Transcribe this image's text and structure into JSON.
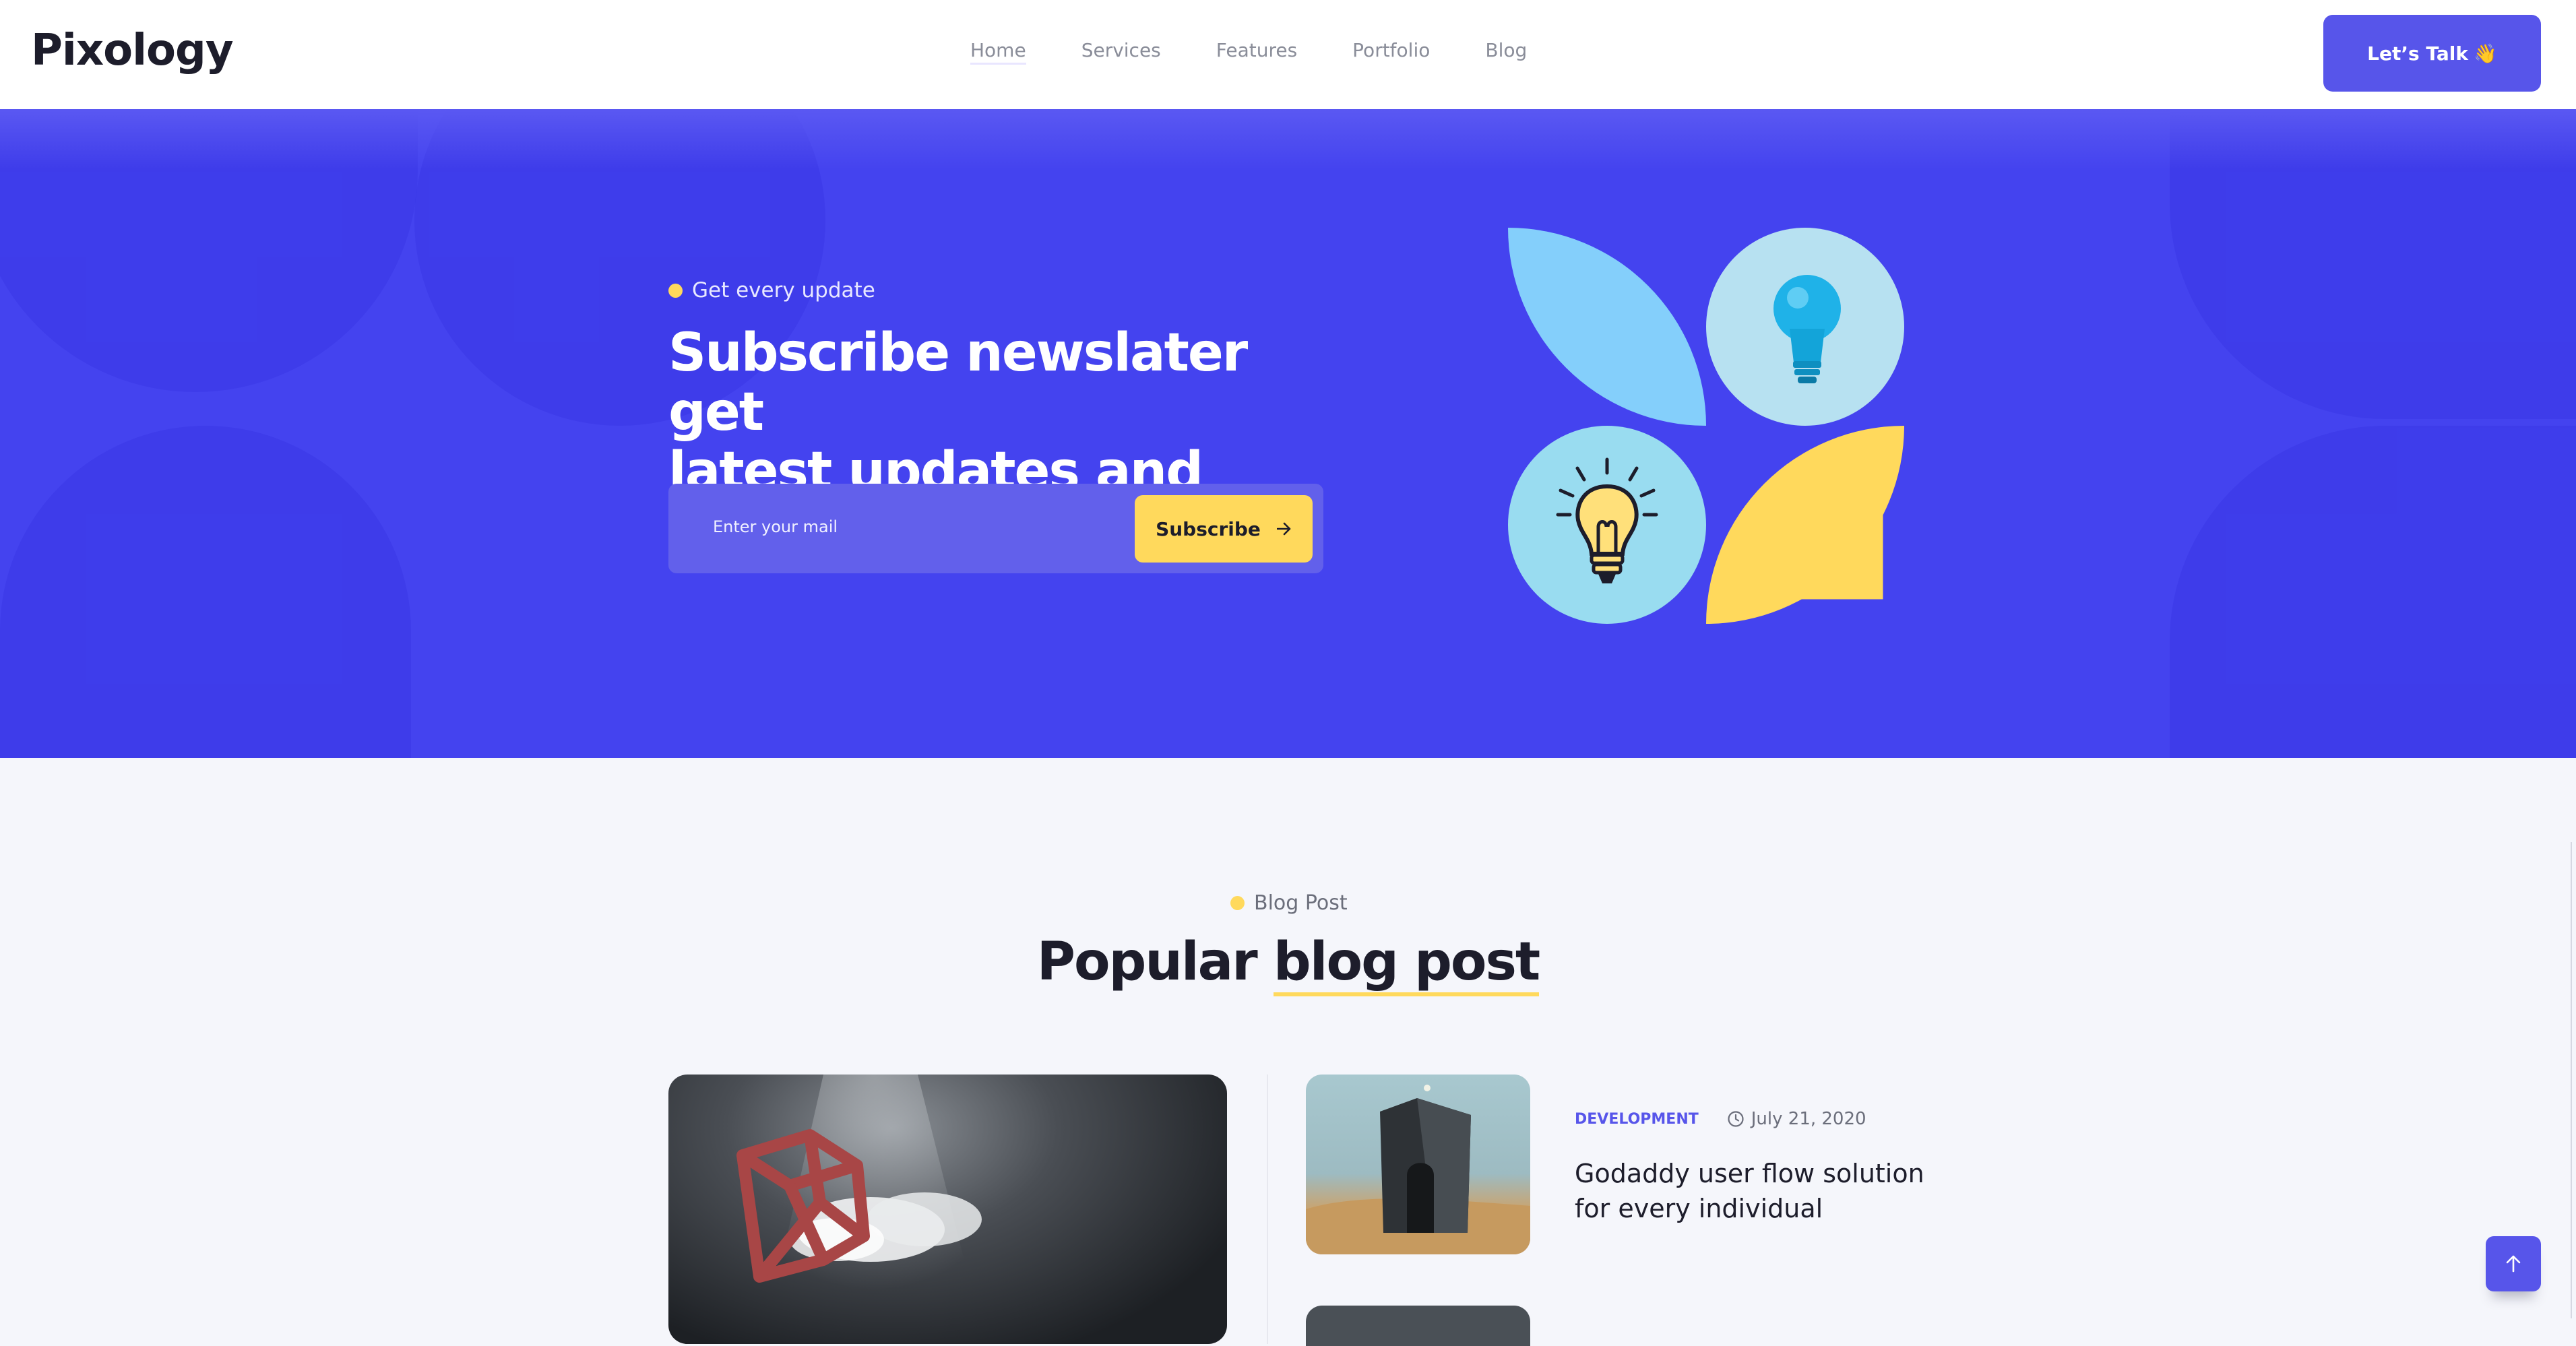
{
  "header": {
    "logo": "Pixology",
    "nav": [
      {
        "label": "Home"
      },
      {
        "label": "Services"
      },
      {
        "label": "Features"
      },
      {
        "label": "Portfolio"
      },
      {
        "label": "Blog"
      }
    ],
    "cta_label": "Let’s Talk",
    "cta_icon": "👋"
  },
  "hero": {
    "eyebrow": "Get every update",
    "title_line1": "Subscribe newslater get",
    "title_line2": "latest updates and deals",
    "email_placeholder": "Enter your mail",
    "subscribe_label": "Subscribe",
    "subscribe_icon": "arrow-right-icon"
  },
  "blog": {
    "label": "Blog Post",
    "heading_plain": "Popular ",
    "heading_highlight": "blog post",
    "post": {
      "category": "DEVELOPMENT",
      "date": "July 21, 2020",
      "title": "Godaddy user flow solution for every individual"
    }
  },
  "colors": {
    "brand": "#5755ea",
    "hero_bg": "#4443ef",
    "accent_yellow": "#ffd95c"
  }
}
